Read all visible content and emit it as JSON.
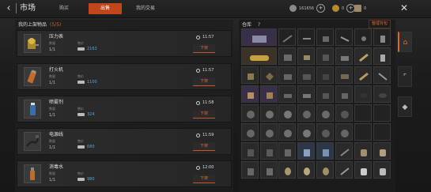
{
  "header": {
    "title": "市场",
    "tabs": [
      {
        "label": "购买",
        "active": false
      },
      {
        "label": "出售",
        "active": true
      },
      {
        "label": "我的交易",
        "active": false
      }
    ],
    "currencies": [
      {
        "icon": "coin-icon",
        "value": "161656"
      },
      {
        "icon": "gold-icon",
        "value": "0"
      },
      {
        "icon": "crate-icon",
        "value": "0"
      }
    ]
  },
  "listings": {
    "title": "我的上架物品",
    "count": "(5/5)",
    "qty_label": "数量",
    "price_label": "售价",
    "delist_label": "下架",
    "items": [
      {
        "name": "压力表",
        "qty": "1/1",
        "price": "2163",
        "time": "11:57",
        "icon": "pressure-gauge-icon"
      },
      {
        "name": "打火机",
        "qty": "1/1",
        "price": "1100",
        "time": "11:57",
        "icon": "lighter-icon"
      },
      {
        "name": "喷雾剂",
        "qty": "1/1",
        "price": "324",
        "time": "11:58",
        "icon": "spray-can-icon"
      },
      {
        "name": "电源线",
        "qty": "1/1",
        "price": "680",
        "time": "11:59",
        "icon": "power-cord-icon"
      },
      {
        "name": "消毒水",
        "qty": "1/1",
        "price": "980",
        "time": "12:00",
        "icon": "disinfectant-icon"
      }
    ]
  },
  "warehouse": {
    "title": "仓库",
    "help_icon": "help-icon",
    "organize_label": "整理背包"
  },
  "side_tabs": [
    {
      "icon": "home-icon",
      "active": true
    },
    {
      "icon": "gun-icon",
      "active": false
    },
    {
      "icon": "tag-icon",
      "active": false
    }
  ],
  "accent": "#c0461b",
  "price_color": "#4ea6d8"
}
